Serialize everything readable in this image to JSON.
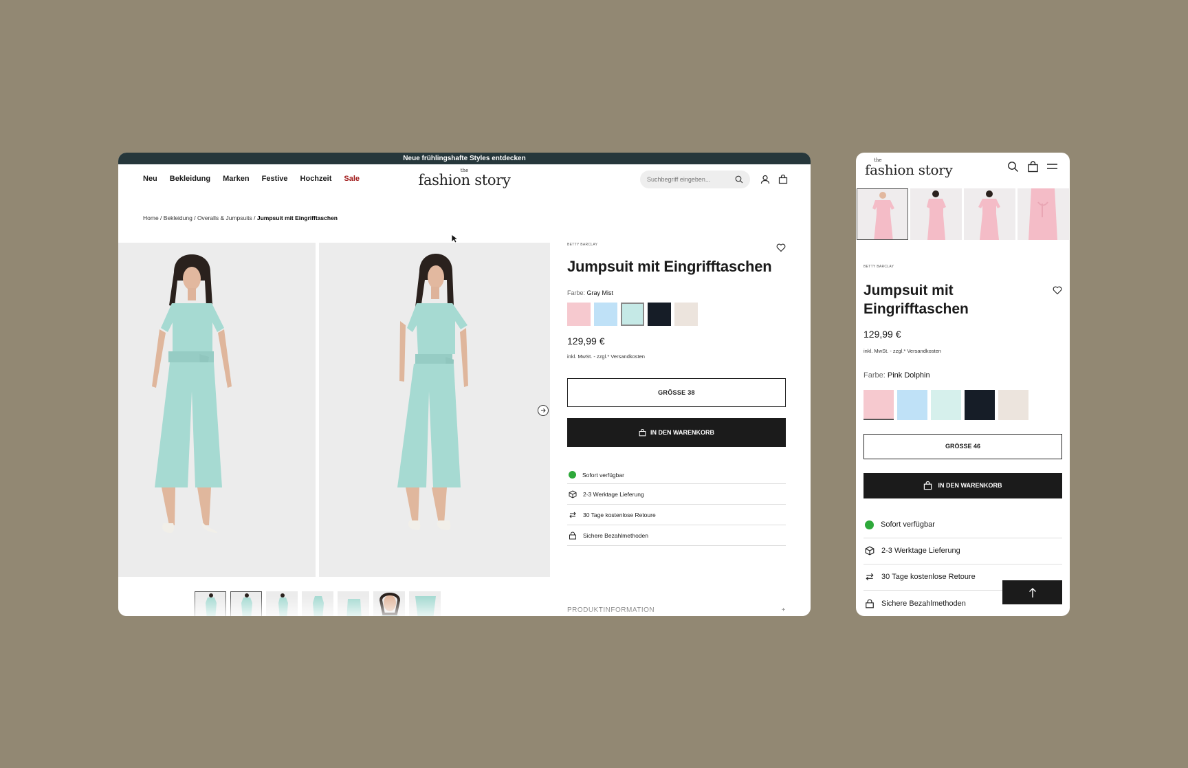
{
  "desktop": {
    "promo": "Neue frühlingshafte Styles entdecken",
    "nav": [
      "Neu",
      "Bekleidung",
      "Marken",
      "Festive",
      "Hochzeit",
      "Sale"
    ],
    "logo_small": "the",
    "logo": "fashion story",
    "search_placeholder": "Suchbegriff eingeben...",
    "breadcrumb": [
      "Home",
      "Bekleidung",
      "Overalls & Jumpsuits",
      "Jumpsuit mit Eingrifftaschen"
    ],
    "brand": "BETTY BARCLAY",
    "title": "Jumpsuit mit Eingrifftaschen",
    "color_label": "Farbe:",
    "color_value": "Gray Mist",
    "swatches": [
      "#f6c9cf",
      "#bfe1f7",
      "#c5e9e6",
      "#161d27",
      "#ece4dd"
    ],
    "price": "129,99 €",
    "tax_note": "inkl. MwSt. - zzgl.* Versandkosten",
    "size_button": "GRÖSSE 38",
    "cart_button": "IN DEN WARENKORB",
    "features": [
      "Sofort verfügbar",
      "2-3 Werktage Lieferung",
      "30 Tage kostenlose Retoure",
      "Sichere Bezahlmethoden"
    ],
    "product_info": "PRODUKTINFORMATION",
    "product_info_toggle": "+"
  },
  "mobile": {
    "logo_small": "the",
    "logo": "fashion story",
    "brand": "BETTY BARCLAY",
    "title": "Jumpsuit mit Eingrifftaschen",
    "price": "129,99 €",
    "tax_note": "inkl. MwSt. - zzgl.* Versandkosten",
    "color_label": "Farbe:",
    "color_value": "Pink Dolphin",
    "swatches": [
      "#f6c9cf",
      "#bfe1f7",
      "#d6f0ec",
      "#161d27",
      "#ece4dd"
    ],
    "size_button": "GRÖSSE 46",
    "cart_button": "IN DEN WARENKORB",
    "features": [
      "Sofort verfügbar",
      "2-3 Werktage Lieferung",
      "30 Tage kostenlose Retoure",
      "Sichere Bezahlmethoden"
    ]
  },
  "colors": {
    "promo_bg": "#26373b",
    "sale": "#a11b1b",
    "jumpsuit_mint": "#a6dad2",
    "jumpsuit_pink": "#f4bcc7",
    "available": "#2ea93a"
  }
}
